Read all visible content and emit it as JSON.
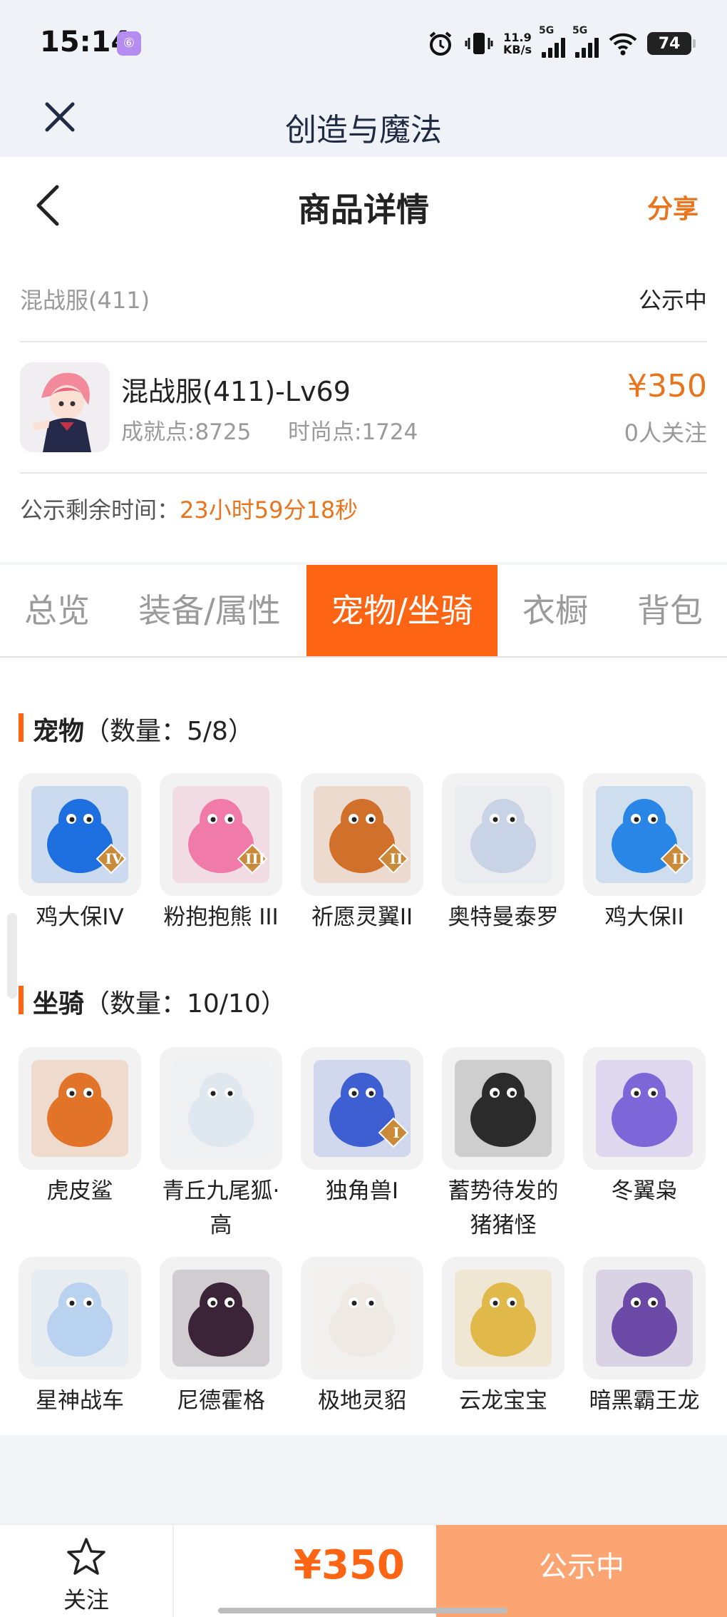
{
  "status_bar": {
    "time": "15:14",
    "app_badge": "⑥",
    "net_speed_value": "11.9",
    "net_speed_unit": "KB/s",
    "sim1": "5G",
    "sim2": "5G",
    "battery": "74"
  },
  "app_bar": {
    "title": "创造与魔法"
  },
  "header": {
    "title": "商品详情",
    "share": "分享"
  },
  "product": {
    "server": "混战服(411)",
    "status": "公示中",
    "name": "混战服(411)-Lv69",
    "achievement": "成就点:8725",
    "fashion": "时尚点:1724",
    "price": "¥350",
    "followers": "0人关注",
    "timer_label": "公示剩余时间：",
    "timer_value": "23小时59分18秒"
  },
  "tabs": [
    {
      "label": "总览"
    },
    {
      "label": "装备/属性"
    },
    {
      "label": "宠物/坐骑",
      "active": true
    },
    {
      "label": "衣橱"
    },
    {
      "label": "背包"
    }
  ],
  "pets": {
    "title": "宠物",
    "count": "（数量：5/8）",
    "items": [
      {
        "name": "鸡大保IV",
        "color": "#1d6fe0",
        "badge": "IV"
      },
      {
        "name": "粉抱抱熊 III",
        "color": "#f07aa8",
        "badge": "III"
      },
      {
        "name": "祈愿灵翼II",
        "color": "#d0702a",
        "badge": "II"
      },
      {
        "name": "奥特曼泰罗",
        "color": "#c9d3e6",
        "badge": ""
      },
      {
        "name": "鸡大保II",
        "color": "#2a86e6",
        "badge": "II"
      }
    ]
  },
  "mounts": {
    "title": "坐骑",
    "count": "（数量：10/10）",
    "items": [
      {
        "name": "虎皮鲨",
        "color": "#e2742a",
        "badge": ""
      },
      {
        "name": "青丘九尾狐·高",
        "color": "#dfe8ee",
        "badge": ""
      },
      {
        "name": "独角兽I",
        "color": "#3d5fd1",
        "badge": "I"
      },
      {
        "name": "蓄势待发的猪猪怪",
        "color": "#2b2b2b",
        "badge": ""
      },
      {
        "name": "冬翼枭",
        "color": "#7d66d8",
        "badge": ""
      },
      {
        "name": "星神战车",
        "color": "#b9d2f0",
        "badge": ""
      },
      {
        "name": "尼德霍格",
        "color": "#3b2338",
        "badge": ""
      },
      {
        "name": "极地灵貂",
        "color": "#efe9e3",
        "badge": ""
      },
      {
        "name": "云龙宝宝",
        "color": "#e1b94a",
        "badge": ""
      },
      {
        "name": "暗黑霸王龙",
        "color": "#6a4aa6",
        "badge": ""
      }
    ]
  },
  "bottom": {
    "follow": "关注",
    "price": "¥350",
    "action": "公示中"
  },
  "colors": {
    "accent": "#fd6413",
    "price": "#e8741e",
    "action": "#fda572"
  }
}
